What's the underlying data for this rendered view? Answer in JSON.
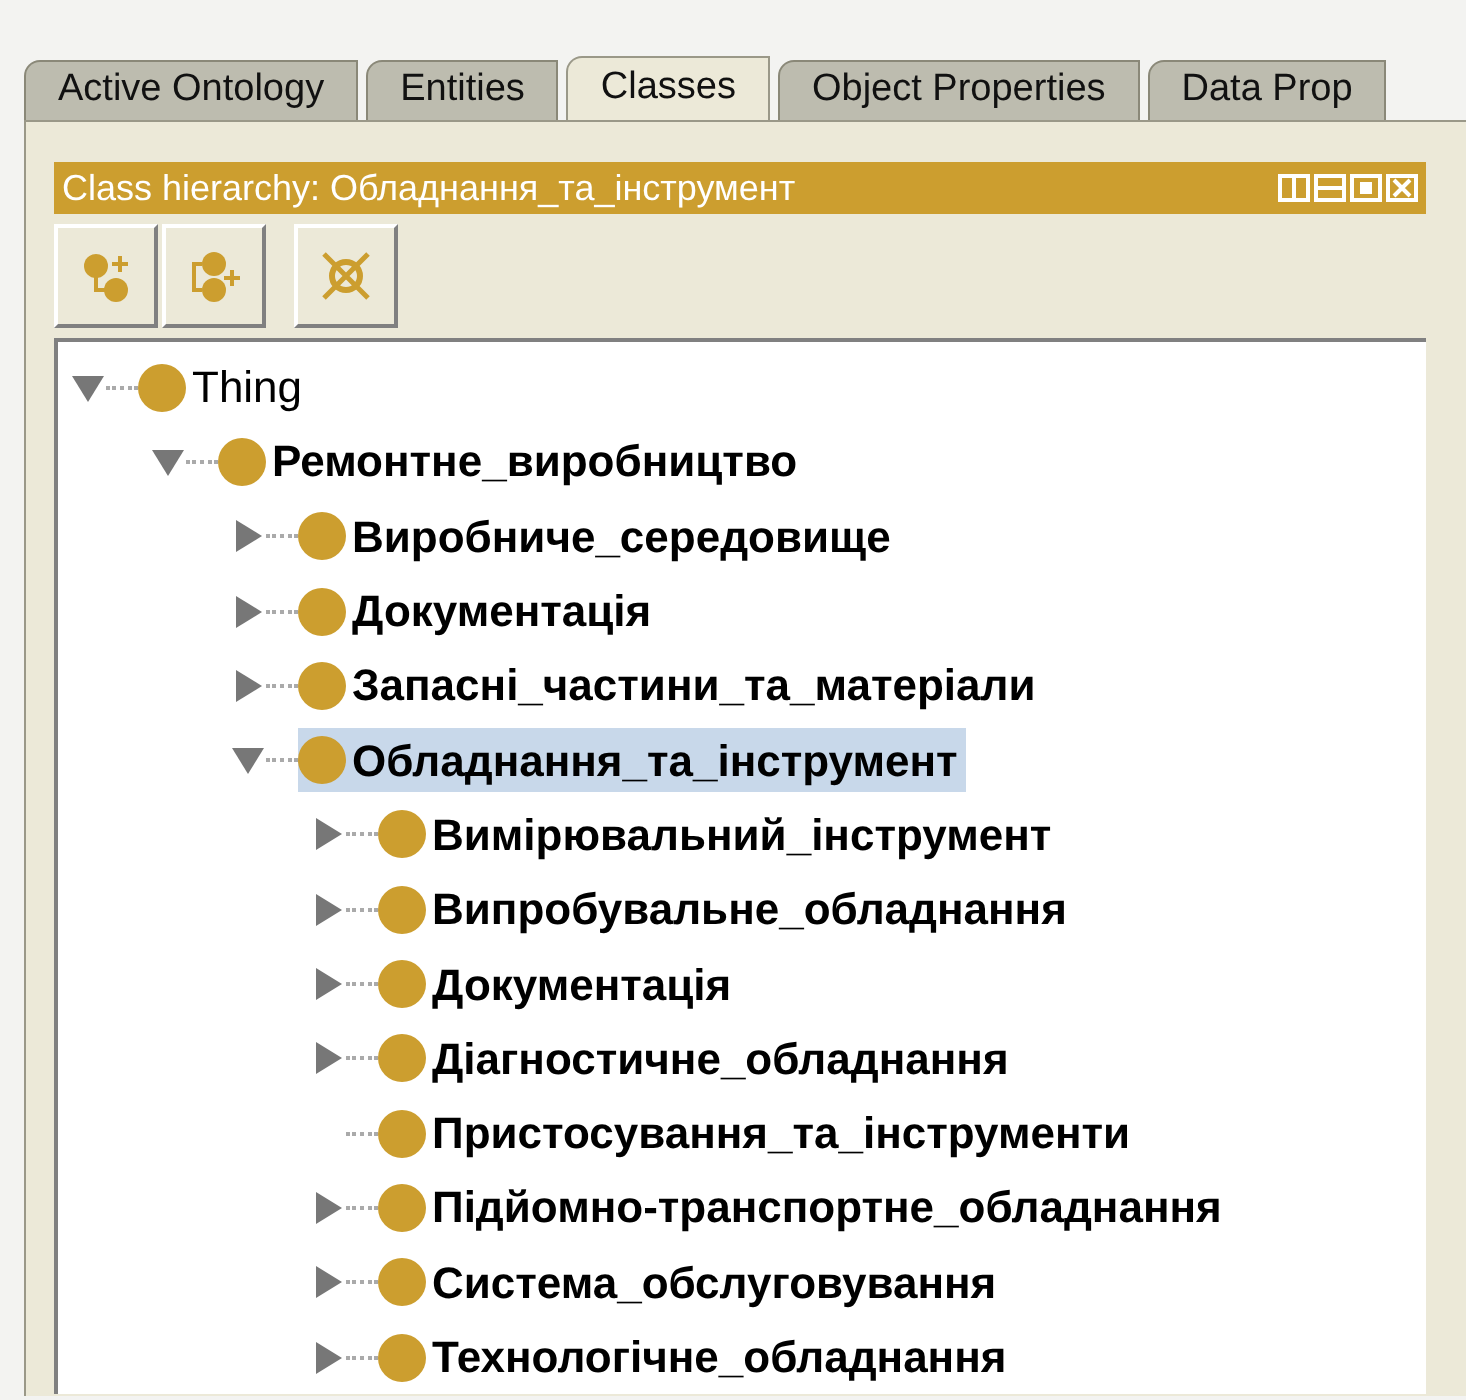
{
  "tabs": [
    {
      "label": "Active Ontology",
      "selected": false
    },
    {
      "label": "Entities",
      "selected": false
    },
    {
      "label": "Classes",
      "selected": true
    },
    {
      "label": "Object Properties",
      "selected": false
    },
    {
      "label": "Data Prop",
      "selected": false
    }
  ],
  "view": {
    "title": "Class hierarchy: Обладнання_та_інструмент"
  },
  "toolbar": [
    {
      "kind": "add-subclass"
    },
    {
      "kind": "add-sibling"
    },
    {
      "kind": "delete"
    }
  ],
  "tree": [
    {
      "label": "Thing",
      "expandable": true,
      "expanded": true,
      "bold": false,
      "selected": false,
      "children": [
        {
          "label": "Ремонтне_виробництво",
          "expandable": true,
          "expanded": true,
          "bold": true,
          "selected": false,
          "children": [
            {
              "label": "Виробниче_середовище",
              "expandable": true,
              "expanded": false,
              "bold": true,
              "selected": false
            },
            {
              "label": "Документація",
              "expandable": true,
              "expanded": false,
              "bold": true,
              "selected": false
            },
            {
              "label": "Запасні_частини_та_матеріали",
              "expandable": true,
              "expanded": false,
              "bold": true,
              "selected": false
            },
            {
              "label": "Обладнання_та_інструмент",
              "expandable": true,
              "expanded": true,
              "bold": true,
              "selected": true,
              "children": [
                {
                  "label": "Вимірювальний_інструмент",
                  "expandable": true,
                  "expanded": false,
                  "bold": true,
                  "selected": false
                },
                {
                  "label": "Випробувальне_обладнання",
                  "expandable": true,
                  "expanded": false,
                  "bold": true,
                  "selected": false
                },
                {
                  "label": "Документація",
                  "expandable": true,
                  "expanded": false,
                  "bold": true,
                  "selected": false
                },
                {
                  "label": "Діагностичне_обладнання",
                  "expandable": true,
                  "expanded": false,
                  "bold": true,
                  "selected": false
                },
                {
                  "label": "Пристосування_та_інструменти",
                  "expandable": false,
                  "expanded": false,
                  "bold": true,
                  "selected": false
                },
                {
                  "label": "Підйомно-транспортне_обладнання",
                  "expandable": true,
                  "expanded": false,
                  "bold": true,
                  "selected": false
                },
                {
                  "label": "Система_обслуговування",
                  "expandable": true,
                  "expanded": false,
                  "bold": true,
                  "selected": false
                },
                {
                  "label": "Технологічне_обладнання",
                  "expandable": true,
                  "expanded": false,
                  "bold": true,
                  "selected": false
                }
              ]
            }
          ]
        }
      ]
    }
  ]
}
